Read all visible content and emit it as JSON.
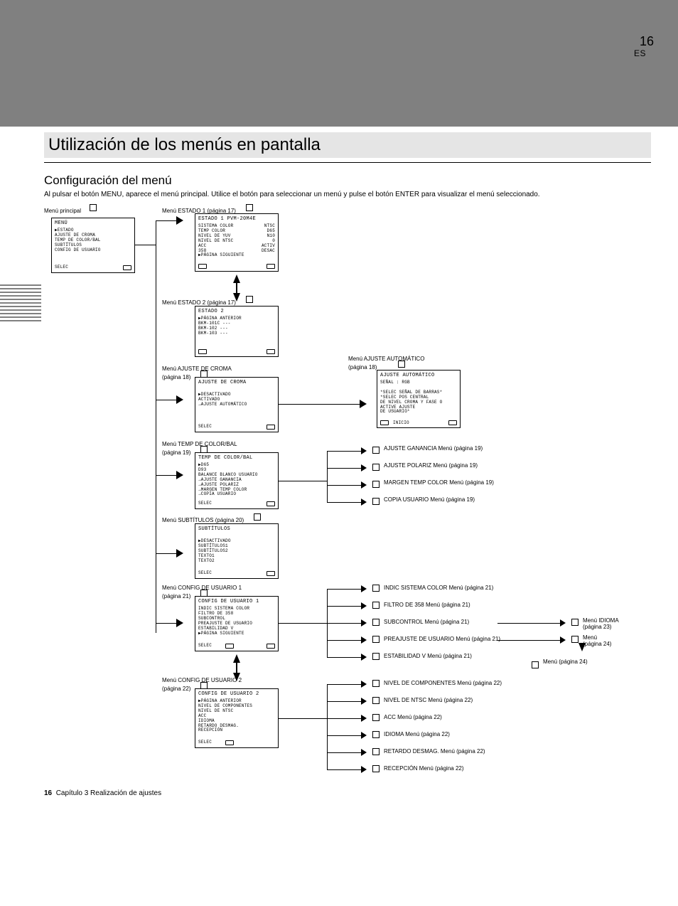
{
  "page_number": "16",
  "lang_tab": "ES",
  "header_title": "Utilización de los menús en pantalla",
  "subtitle": "Configuración del menú",
  "press_menu": "Al pulsar el botón MENU, aparece el menú principal. Utilice el botón  para seleccionar un menú y pulse el botón ENTER para visualizar el menú seleccionado.",
  "sidebar_text": "Capítulo 3  Realización de ajustes",
  "chapter_line": "Capítulo 3  Realización de ajustes",
  "labels": {
    "main": "Menú principal",
    "s1": "Menú ESTADO 1",
    "s1_sub": "(página 17)",
    "s2": "Menú ESTADO 2",
    "s2_sub": "(página 17)",
    "chroma": "Menú AJUSTE DE CROMA",
    "chroma_sub": "(página 18)",
    "temp": "Menú TEMP DE COLOR/BAL",
    "temp_sub": "(página 19)",
    "aa": "Menú AJUSTE AUTOMÁTICO",
    "aa_sub": "(página 18)",
    "g": "Menú (página 19)",
    "g1": "AJUSTE GANANCIA",
    "g2": "AJUSTE POLARIZ",
    "g3": "MARGEN TEMP COLOR",
    "g4": "COPIA USUARIO",
    "subt": "Menú SUBTÍTULOS",
    "subt_sub": "(página 20)",
    "cu1": "Menú CONFIG DE USUARIO 1",
    "cu1_sub": "(página 21)",
    "cu2": "Menú CONFIG DE USUARIO 2",
    "cu2_sub": "(página 22)",
    "c1": "Menú (página 21)",
    "c1a": "INDIC SISTEMA COLOR",
    "c1b": "FILTRO DE 358",
    "c1c": "SUBCONTROL",
    "c1d": "PREAJUSTE DE USUARIO",
    "c1e": "ESTABILIDAD V",
    "c2a": "NIVEL DE COMPONENTES",
    "c2b": "NIVEL DE NTSC",
    "c2c": "ACC",
    "c2d": "IDIOMA",
    "c2e": "RETARDO DESMAG.",
    "c2f": "RECEPCIÓN",
    "c2m": "Menú (página 22)",
    "lang": "Menú IDIOMA",
    "lang_sub": "(página 23)",
    "beep": "Menú",
    "beep_sub": "(página 24)",
    "remote": "Menú",
    "remote_sub": "(página 24)"
  },
  "menus": {
    "main": {
      "title": "MENÚ",
      "items": [
        "▶ESTADO",
        " AJUSTE DE CROMA",
        " TEMP DE COLOR/BAL",
        " SUBTÍTULOS",
        " CONFIG DE USUARIO"
      ],
      "foot": "  SELEC"
    },
    "s1": {
      "title": "ESTADO 1        PVM-20M4E",
      "rows": [
        [
          "SISTEMA COLOR",
          "NTSC"
        ],
        [
          "TEMP COLOR",
          "D65"
        ],
        [
          "NIVEL DE YUV",
          "N10"
        ],
        [
          "NIVEL DE NTSC",
          "0"
        ],
        [
          "ACC",
          "ACTIV"
        ],
        [
          "358",
          "DESAC"
        ],
        [
          "▶PÁGINA SIGUIENTE",
          ""
        ]
      ]
    },
    "s2": {
      "title": "ESTADO 2",
      "items": [
        "▶PÁGINA ANTERIOR",
        " BKM-101C      ---",
        " BKM-102       ---",
        " BKM-103       ---"
      ]
    },
    "chroma": {
      "title": "AJUSTE DE CROMA",
      "items": [
        "▶DESACTIVADO",
        " ACTIVADO",
        " →AJUSTE AUTOMÁTICO"
      ],
      "foot": "  SELEC"
    },
    "aa": {
      "title": "AJUSTE AUTOMÁTICO",
      "body": [
        "SEÑAL :  RGB",
        "",
        "*SELEC SEÑAL DE BARRAS*",
        "*SELEC POS CENTRAL",
        "DE NIVEL CROMA Y FASE O",
        "ACTIVE AJUSTE",
        "DE USUARIO*",
        "   INICIO"
      ]
    },
    "temp": {
      "title": "TEMP DE COLOR/BAL",
      "items": [
        "▶D65",
        " D93",
        " BALANCE BLANCO USUARIO",
        " →AJUSTE GANANCIA",
        " →AJUSTE POLARIZ",
        " →MARGEN TEMP COLOR",
        " →COPIA USUARIO"
      ],
      "foot": "  SELEC"
    },
    "subt": {
      "title": "SUBTÍTULOS",
      "items": [
        "▶DESACTIVADO",
        " SUBTÍTULOS1",
        " SUBTÍTULOS2",
        " TEXTO1",
        " TEXTO2"
      ],
      "foot": "  SELEC"
    },
    "cu1": {
      "title": "CONFIG DE USUARIO 1",
      "items": [
        " INDIC SISTEMA COLOR",
        " FILTRO DE 358",
        " SUBCONTROL",
        " PREAJUSTE DE USUARIO",
        " ESTABILIDAD V",
        "▶PÁGINA SIGUIENTE"
      ],
      "foot": "  SELEC"
    },
    "cu2": {
      "title": "CONFIG DE USUARIO 2",
      "items": [
        "▶PÁGINA ANTERIOR",
        " NIVEL DE COMPONENTES",
        " NIVEL DE NTSC",
        " ACC",
        " IDIOMA",
        " RETARDO DESMAG.",
        " RECEPCIÓN"
      ],
      "foot": "  SELEC"
    }
  }
}
